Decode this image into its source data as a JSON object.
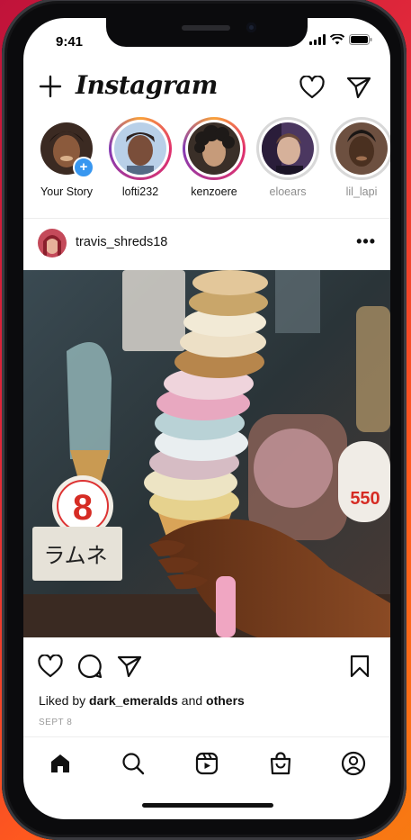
{
  "status_bar": {
    "time": "9:41"
  },
  "header": {
    "logo_text": "Instagram"
  },
  "stories": [
    {
      "name": "Your Story",
      "state": "own",
      "colors": [
        "#3b2a22",
        "#8b5a3c",
        "#d9b08a"
      ]
    },
    {
      "name": "lofti232",
      "state": "unseen",
      "colors": [
        "#2d2220",
        "#7a4e3a",
        "#b9d0e8"
      ]
    },
    {
      "name": "kenzoere",
      "state": "unseen",
      "colors": [
        "#1e1a18",
        "#6b4a34",
        "#c69b7a"
      ]
    },
    {
      "name": "eloears",
      "state": "seen",
      "colors": [
        "#2a1d3a",
        "#9c7d6c",
        "#4b3760"
      ]
    },
    {
      "name": "lil_lapi",
      "state": "seen",
      "colors": [
        "#1a1614",
        "#4a3020",
        "#a07050"
      ]
    }
  ],
  "post": {
    "username": "travis_shreds18",
    "more_label": "•••",
    "liked_prefix": "Liked by",
    "liked_user": "dark_emeralds",
    "liked_and": "and",
    "liked_others": "others",
    "date": "SEPT 8",
    "photo_signs": {
      "number": "8",
      "katakana": "ラムネ",
      "price": "550"
    }
  },
  "colors": {
    "story_ring": [
      "#f9a23b",
      "#e1306c",
      "#c13584",
      "#833ab4"
    ],
    "add_badge": "#3897f0",
    "seen_ring": "#d8d8d8"
  },
  "icons": {
    "header": [
      "plus-icon",
      "heart-icon",
      "paper-plane-icon"
    ],
    "actions": [
      "heart-icon",
      "comment-icon",
      "share-icon",
      "bookmark-icon"
    ],
    "tabs": [
      "home-icon",
      "search-icon",
      "reels-icon",
      "shop-icon",
      "profile-icon"
    ]
  }
}
